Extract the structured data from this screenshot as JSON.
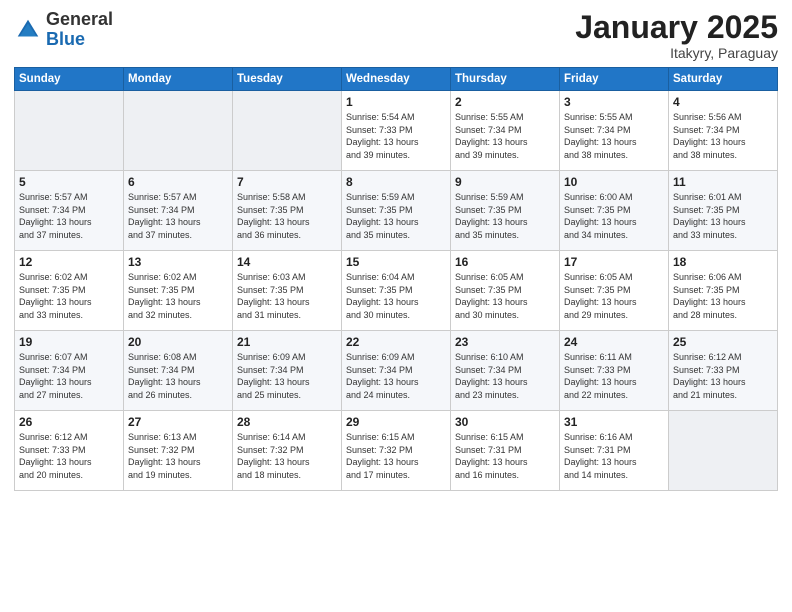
{
  "header": {
    "logo_general": "General",
    "logo_blue": "Blue",
    "month": "January 2025",
    "location": "Itakyry, Paraguay"
  },
  "weekdays": [
    "Sunday",
    "Monday",
    "Tuesday",
    "Wednesday",
    "Thursday",
    "Friday",
    "Saturday"
  ],
  "weeks": [
    [
      {
        "day": "",
        "info": ""
      },
      {
        "day": "",
        "info": ""
      },
      {
        "day": "",
        "info": ""
      },
      {
        "day": "1",
        "info": "Sunrise: 5:54 AM\nSunset: 7:33 PM\nDaylight: 13 hours\nand 39 minutes."
      },
      {
        "day": "2",
        "info": "Sunrise: 5:55 AM\nSunset: 7:34 PM\nDaylight: 13 hours\nand 39 minutes."
      },
      {
        "day": "3",
        "info": "Sunrise: 5:55 AM\nSunset: 7:34 PM\nDaylight: 13 hours\nand 38 minutes."
      },
      {
        "day": "4",
        "info": "Sunrise: 5:56 AM\nSunset: 7:34 PM\nDaylight: 13 hours\nand 38 minutes."
      }
    ],
    [
      {
        "day": "5",
        "info": "Sunrise: 5:57 AM\nSunset: 7:34 PM\nDaylight: 13 hours\nand 37 minutes."
      },
      {
        "day": "6",
        "info": "Sunrise: 5:57 AM\nSunset: 7:34 PM\nDaylight: 13 hours\nand 37 minutes."
      },
      {
        "day": "7",
        "info": "Sunrise: 5:58 AM\nSunset: 7:35 PM\nDaylight: 13 hours\nand 36 minutes."
      },
      {
        "day": "8",
        "info": "Sunrise: 5:59 AM\nSunset: 7:35 PM\nDaylight: 13 hours\nand 35 minutes."
      },
      {
        "day": "9",
        "info": "Sunrise: 5:59 AM\nSunset: 7:35 PM\nDaylight: 13 hours\nand 35 minutes."
      },
      {
        "day": "10",
        "info": "Sunrise: 6:00 AM\nSunset: 7:35 PM\nDaylight: 13 hours\nand 34 minutes."
      },
      {
        "day": "11",
        "info": "Sunrise: 6:01 AM\nSunset: 7:35 PM\nDaylight: 13 hours\nand 33 minutes."
      }
    ],
    [
      {
        "day": "12",
        "info": "Sunrise: 6:02 AM\nSunset: 7:35 PM\nDaylight: 13 hours\nand 33 minutes."
      },
      {
        "day": "13",
        "info": "Sunrise: 6:02 AM\nSunset: 7:35 PM\nDaylight: 13 hours\nand 32 minutes."
      },
      {
        "day": "14",
        "info": "Sunrise: 6:03 AM\nSunset: 7:35 PM\nDaylight: 13 hours\nand 31 minutes."
      },
      {
        "day": "15",
        "info": "Sunrise: 6:04 AM\nSunset: 7:35 PM\nDaylight: 13 hours\nand 30 minutes."
      },
      {
        "day": "16",
        "info": "Sunrise: 6:05 AM\nSunset: 7:35 PM\nDaylight: 13 hours\nand 30 minutes."
      },
      {
        "day": "17",
        "info": "Sunrise: 6:05 AM\nSunset: 7:35 PM\nDaylight: 13 hours\nand 29 minutes."
      },
      {
        "day": "18",
        "info": "Sunrise: 6:06 AM\nSunset: 7:35 PM\nDaylight: 13 hours\nand 28 minutes."
      }
    ],
    [
      {
        "day": "19",
        "info": "Sunrise: 6:07 AM\nSunset: 7:34 PM\nDaylight: 13 hours\nand 27 minutes."
      },
      {
        "day": "20",
        "info": "Sunrise: 6:08 AM\nSunset: 7:34 PM\nDaylight: 13 hours\nand 26 minutes."
      },
      {
        "day": "21",
        "info": "Sunrise: 6:09 AM\nSunset: 7:34 PM\nDaylight: 13 hours\nand 25 minutes."
      },
      {
        "day": "22",
        "info": "Sunrise: 6:09 AM\nSunset: 7:34 PM\nDaylight: 13 hours\nand 24 minutes."
      },
      {
        "day": "23",
        "info": "Sunrise: 6:10 AM\nSunset: 7:34 PM\nDaylight: 13 hours\nand 23 minutes."
      },
      {
        "day": "24",
        "info": "Sunrise: 6:11 AM\nSunset: 7:33 PM\nDaylight: 13 hours\nand 22 minutes."
      },
      {
        "day": "25",
        "info": "Sunrise: 6:12 AM\nSunset: 7:33 PM\nDaylight: 13 hours\nand 21 minutes."
      }
    ],
    [
      {
        "day": "26",
        "info": "Sunrise: 6:12 AM\nSunset: 7:33 PM\nDaylight: 13 hours\nand 20 minutes."
      },
      {
        "day": "27",
        "info": "Sunrise: 6:13 AM\nSunset: 7:32 PM\nDaylight: 13 hours\nand 19 minutes."
      },
      {
        "day": "28",
        "info": "Sunrise: 6:14 AM\nSunset: 7:32 PM\nDaylight: 13 hours\nand 18 minutes."
      },
      {
        "day": "29",
        "info": "Sunrise: 6:15 AM\nSunset: 7:32 PM\nDaylight: 13 hours\nand 17 minutes."
      },
      {
        "day": "30",
        "info": "Sunrise: 6:15 AM\nSunset: 7:31 PM\nDaylight: 13 hours\nand 16 minutes."
      },
      {
        "day": "31",
        "info": "Sunrise: 6:16 AM\nSunset: 7:31 PM\nDaylight: 13 hours\nand 14 minutes."
      },
      {
        "day": "",
        "info": ""
      }
    ]
  ]
}
